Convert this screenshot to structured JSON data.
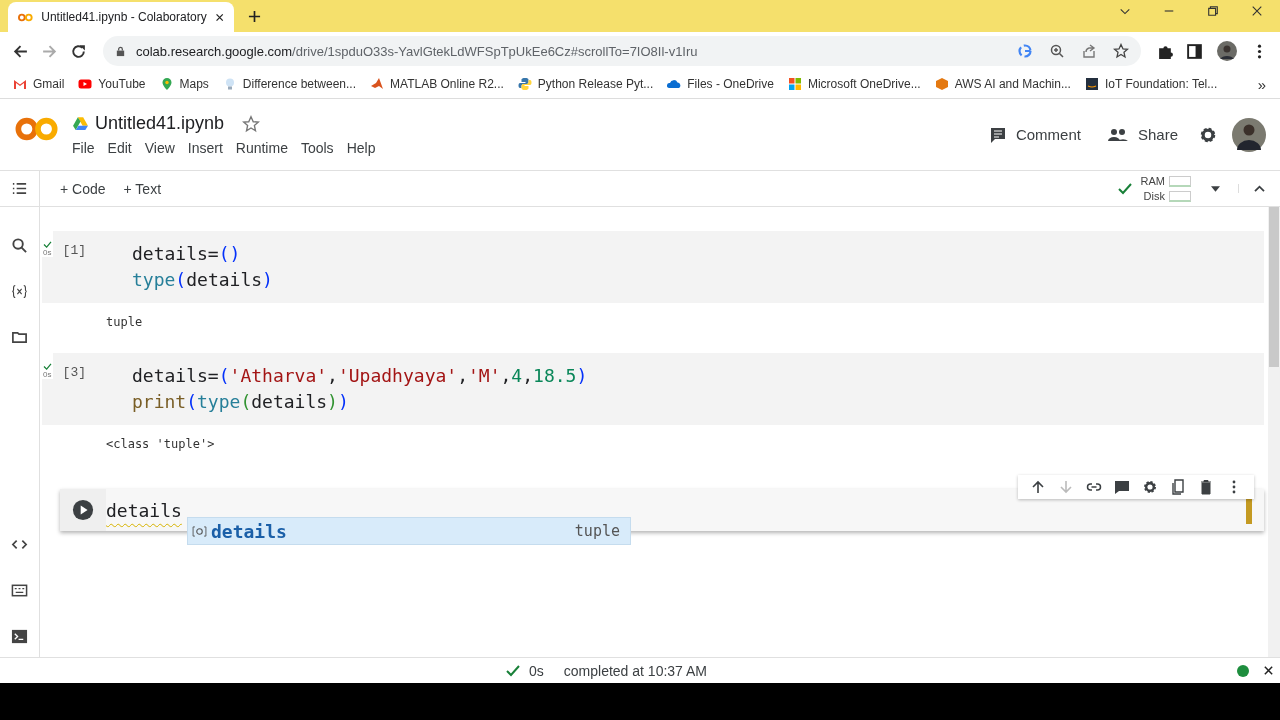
{
  "browser": {
    "tab_title": "Untitled41.ipynb - Colaboratory",
    "url_host": "colab.research.google.com",
    "url_path": "/drive/1spduO33s-YavlGtekLdWFSpTpUkEe6Cz#scrollTo=7IO8Il-v1Iru",
    "bookmarks": [
      {
        "label": "Gmail"
      },
      {
        "label": "YouTube"
      },
      {
        "label": "Maps"
      },
      {
        "label": "Difference between..."
      },
      {
        "label": "MATLAB Online R2..."
      },
      {
        "label": "Python Release Pyt..."
      },
      {
        "label": "Files - OneDrive"
      },
      {
        "label": "Microsoft OneDrive..."
      },
      {
        "label": "AWS AI and Machin..."
      },
      {
        "label": "IoT Foundation: Tel..."
      }
    ],
    "more": "»"
  },
  "notebook": {
    "title": "Untitled41.ipynb",
    "menu": [
      "File",
      "Edit",
      "View",
      "Insert",
      "Runtime",
      "Tools",
      "Help"
    ],
    "comment": "Comment",
    "share": "Share",
    "add_code": "+ Code",
    "add_text": "+ Text",
    "ram": "RAM",
    "disk": "Disk"
  },
  "cells": [
    {
      "count": "[1]",
      "time": "0s",
      "lines": [
        [
          {
            "kind": "plain",
            "text": "details="
          },
          {
            "kind": "paren1",
            "text": "()"
          }
        ],
        [
          {
            "kind": "type",
            "text": "type"
          },
          {
            "kind": "paren1",
            "text": "("
          },
          {
            "kind": "plain",
            "text": "details"
          },
          {
            "kind": "paren1",
            "text": ")"
          }
        ]
      ],
      "output": "tuple"
    },
    {
      "count": "[3]",
      "time": "0s",
      "lines": [
        [
          {
            "kind": "plain",
            "text": "details="
          },
          {
            "kind": "paren1",
            "text": "("
          },
          {
            "kind": "str",
            "text": "'Atharva'"
          },
          {
            "kind": "plain",
            "text": ","
          },
          {
            "kind": "str",
            "text": "'Upadhyaya'"
          },
          {
            "kind": "plain",
            "text": ","
          },
          {
            "kind": "str",
            "text": "'M'"
          },
          {
            "kind": "plain",
            "text": ","
          },
          {
            "kind": "num",
            "text": "4"
          },
          {
            "kind": "plain",
            "text": ","
          },
          {
            "kind": "num",
            "text": "18.5"
          },
          {
            "kind": "paren1",
            "text": ")"
          }
        ],
        [
          {
            "kind": "func",
            "text": "print"
          },
          {
            "kind": "paren1",
            "text": "("
          },
          {
            "kind": "type",
            "text": "type"
          },
          {
            "kind": "paren2",
            "text": "("
          },
          {
            "kind": "plain",
            "text": "details"
          },
          {
            "kind": "paren2",
            "text": ")"
          },
          {
            "kind": "paren1",
            "text": ")"
          }
        ]
      ],
      "output": "<class 'tuple'>"
    }
  ],
  "active_cell": {
    "text": "details",
    "suggestion": {
      "label": "details",
      "type": "tuple"
    }
  },
  "status": {
    "time": "0s",
    "message": "completed at 10:37 AM"
  }
}
